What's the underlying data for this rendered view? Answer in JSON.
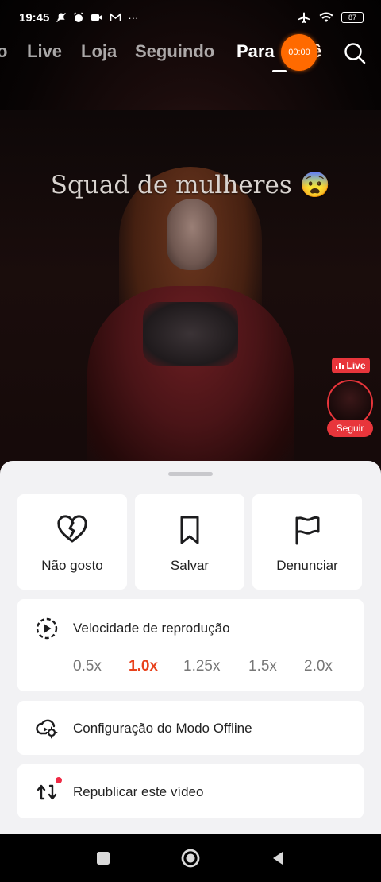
{
  "status_bar": {
    "time": "19:45",
    "left_icons": [
      "mute-icon",
      "alarm-icon",
      "video-icon",
      "mail-icon",
      "more-icon"
    ],
    "more": "···",
    "right_icons": [
      "airplane-icon",
      "wifi-icon"
    ],
    "battery": "87"
  },
  "top_tabs": [
    {
      "label": "o",
      "active": false
    },
    {
      "label": "Live",
      "active": false
    },
    {
      "label": "Loja",
      "active": false
    },
    {
      "label": "Seguindo",
      "active": false
    },
    {
      "label": "Para",
      "active": true
    },
    {
      "label": "ê",
      "active": true
    }
  ],
  "timer": "00:00",
  "video": {
    "caption": "Squad de mulheres 😨"
  },
  "live_badge": "Live",
  "follow_label": "Seguir",
  "sheet": {
    "actions": [
      {
        "label": "Não gosto",
        "icon": "broken-heart-icon"
      },
      {
        "label": "Salvar",
        "icon": "bookmark-icon"
      },
      {
        "label": "Denunciar",
        "icon": "flag-icon"
      }
    ],
    "speed": {
      "title": "Velocidade de reprodução",
      "icon": "playback-speed-icon",
      "options": [
        "0.5x",
        "1.0x",
        "1.25x",
        "1.5x",
        "2.0x"
      ],
      "selected": "1.0x"
    },
    "offline": {
      "label": "Configuração do Modo Offline",
      "icon": "cloud-settings-icon"
    },
    "repost": {
      "label": "Republicar este vídeo",
      "icon": "repost-icon"
    }
  },
  "colors": {
    "accent": "#e8421c",
    "live_red": "#e8353b",
    "timer_orange": "#ff6a00"
  }
}
